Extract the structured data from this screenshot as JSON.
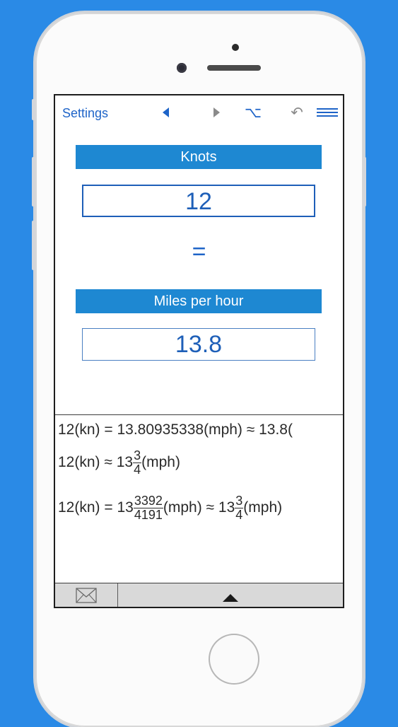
{
  "toolbar": {
    "settings_label": "Settings",
    "icons": [
      "back-arrow-icon",
      "forward-arrow-icon",
      "option-key-icon",
      "undo-icon",
      "menu-icon"
    ],
    "undo_glyph": "↶",
    "option_glyph": "⌥"
  },
  "converter": {
    "from_unit": "Knots",
    "input_value": "12",
    "equals_sign": "=",
    "to_unit": "Miles per hour",
    "result_value": "13.8"
  },
  "results": {
    "line1": "12(kn) = 13.80935338(mph) ≈ 13.8(",
    "line2_prefix": "12(kn) ≈ 13",
    "line2_frac_num": "3",
    "line2_frac_den": "4",
    "line2_suffix": "(mph)",
    "line3_prefix": "12(kn) = 13",
    "line3_frac_num": "3392",
    "line3_frac_den": "4191",
    "line3_mid": "(mph) ≈ 13",
    "line3_frac2_num": "3",
    "line3_frac2_den": "4",
    "line3_suffix": "(mph)"
  },
  "bottom_bar": {
    "icons": [
      "mail-icon",
      "expand-up-icon"
    ]
  },
  "colors": {
    "background": "#2a8ae6",
    "accent": "#1e64c8",
    "unit_bar": "#1e88d2"
  }
}
